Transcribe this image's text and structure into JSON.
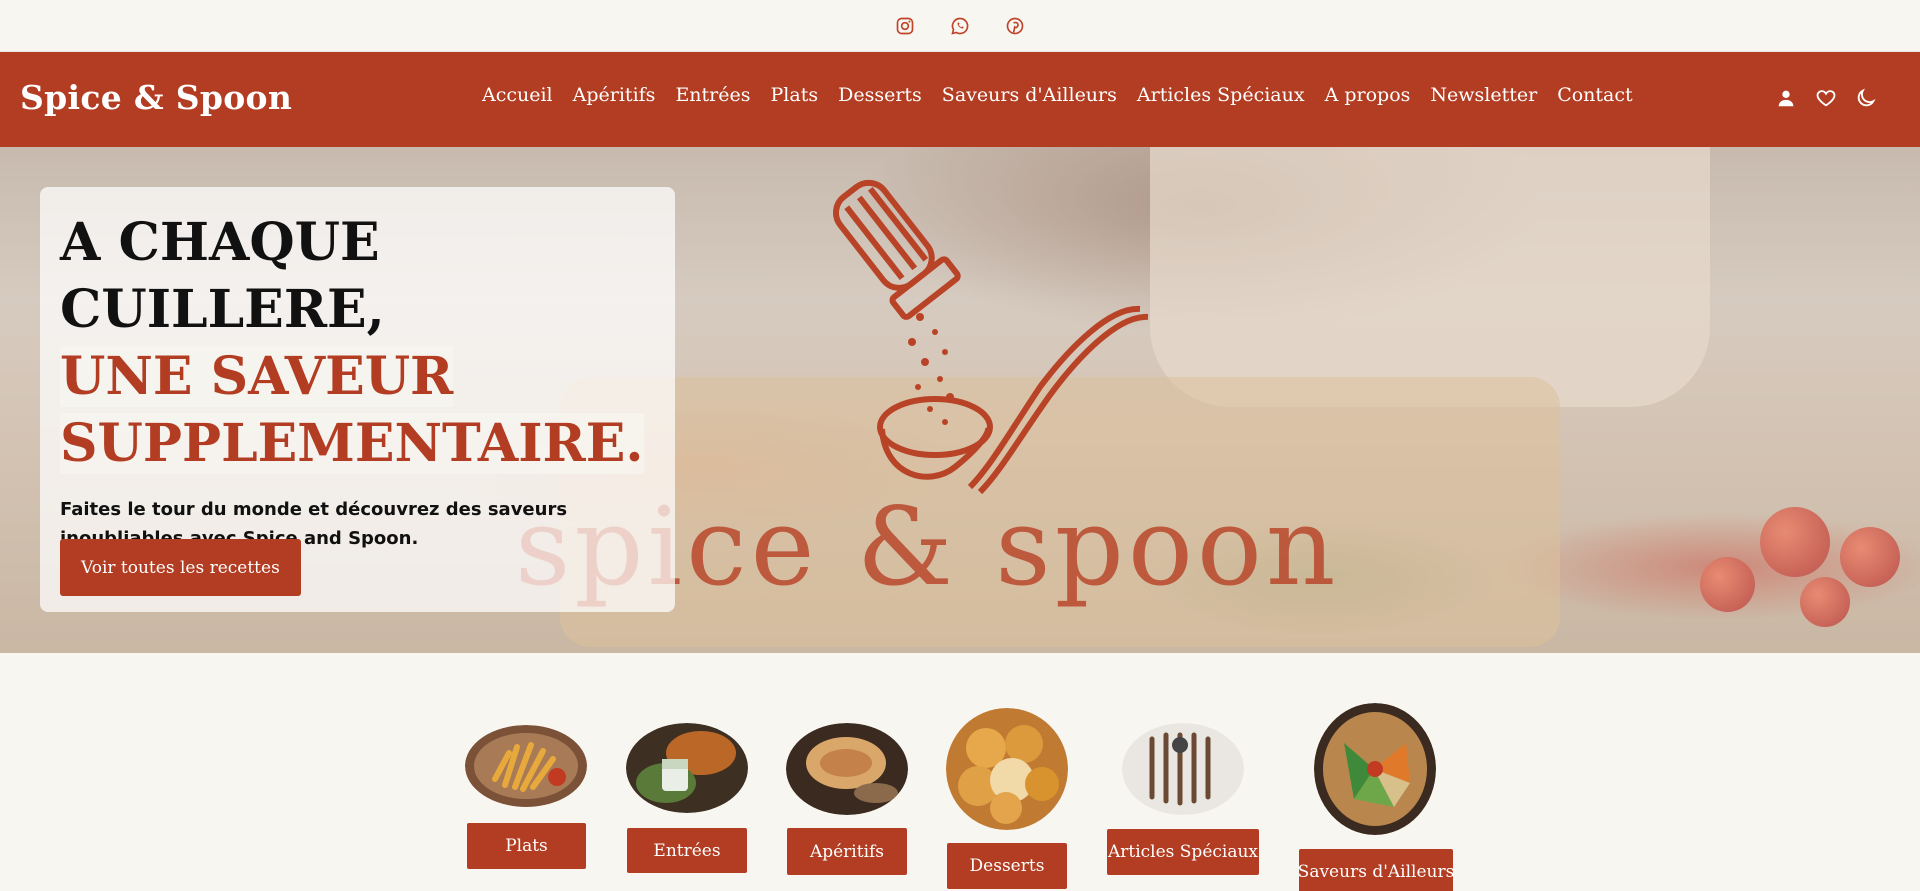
{
  "social": {
    "icons": [
      "instagram-icon",
      "whatsapp-icon",
      "pinterest-icon"
    ],
    "color": "#c0442a"
  },
  "navbar": {
    "brand": "Spice & Spoon",
    "links": [
      "Accueil",
      "Apéritifs",
      "Entrées",
      "Plats",
      "Desserts",
      "Saveurs d'Ailleurs",
      "Articles Spéciaux",
      "A propos",
      "Newsletter",
      "Contact"
    ],
    "actions": [
      "user-icon",
      "heart-icon",
      "moon-icon"
    ],
    "background": "#b23d22"
  },
  "hero": {
    "title_line1": "A CHAQUE CUILLERE,",
    "title_line2": "UNE SAVEUR",
    "title_line3": "SUPPLEMENTAIRE.",
    "subtitle": "Faites le tour du monde et découvrez des saveurs inoubliables avec Spice and Spoon.",
    "button": "Voir toutes les recettes",
    "logo_text": "spice & spoon"
  },
  "categories": [
    {
      "label": "Plats",
      "image": "fries-image"
    },
    {
      "label": "Entrées",
      "image": "verrine-image"
    },
    {
      "label": "Apéritifs",
      "image": "hummus-image"
    },
    {
      "label": "Desserts",
      "image": "beignets-image"
    },
    {
      "label": "Articles Spéciaux",
      "image": "utensils-image"
    },
    {
      "label": "Saveurs d'Ailleurs",
      "image": "bowl-image"
    }
  ],
  "colors": {
    "accent": "#b23d22",
    "background": "#f8f6f1"
  }
}
